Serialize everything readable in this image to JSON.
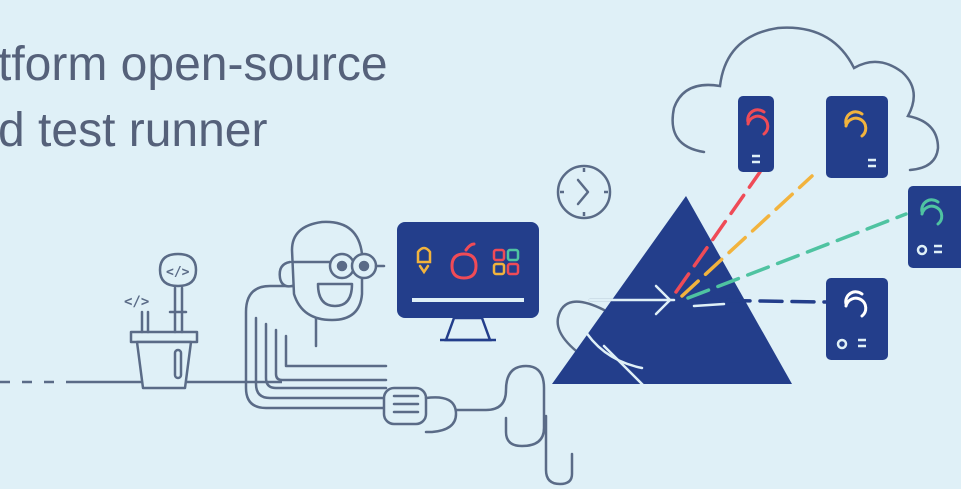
{
  "headline": {
    "line1": "tform open-source",
    "line2": "d test runner"
  },
  "illustration": {
    "plant_code_tag": "</>",
    "plant_bubble_tag": "</>",
    "monitor_icons": [
      "android-icon",
      "apple-icon",
      "windows-icon"
    ],
    "devices": [
      {
        "icon": "refresh-icon",
        "color": "#ef4b57"
      },
      {
        "icon": "refresh-icon",
        "color": "#f2b33d"
      },
      {
        "icon": "refresh-icon",
        "color": "#4fc3a1"
      },
      {
        "icon": "refresh-icon",
        "color": "#ffffff"
      }
    ],
    "colors": {
      "navy": "#233e8b",
      "outline": "#5a6b87",
      "background": "#dff0f7",
      "red": "#ef4b57",
      "yellow": "#f2b33d",
      "green": "#4fc3a1"
    }
  }
}
